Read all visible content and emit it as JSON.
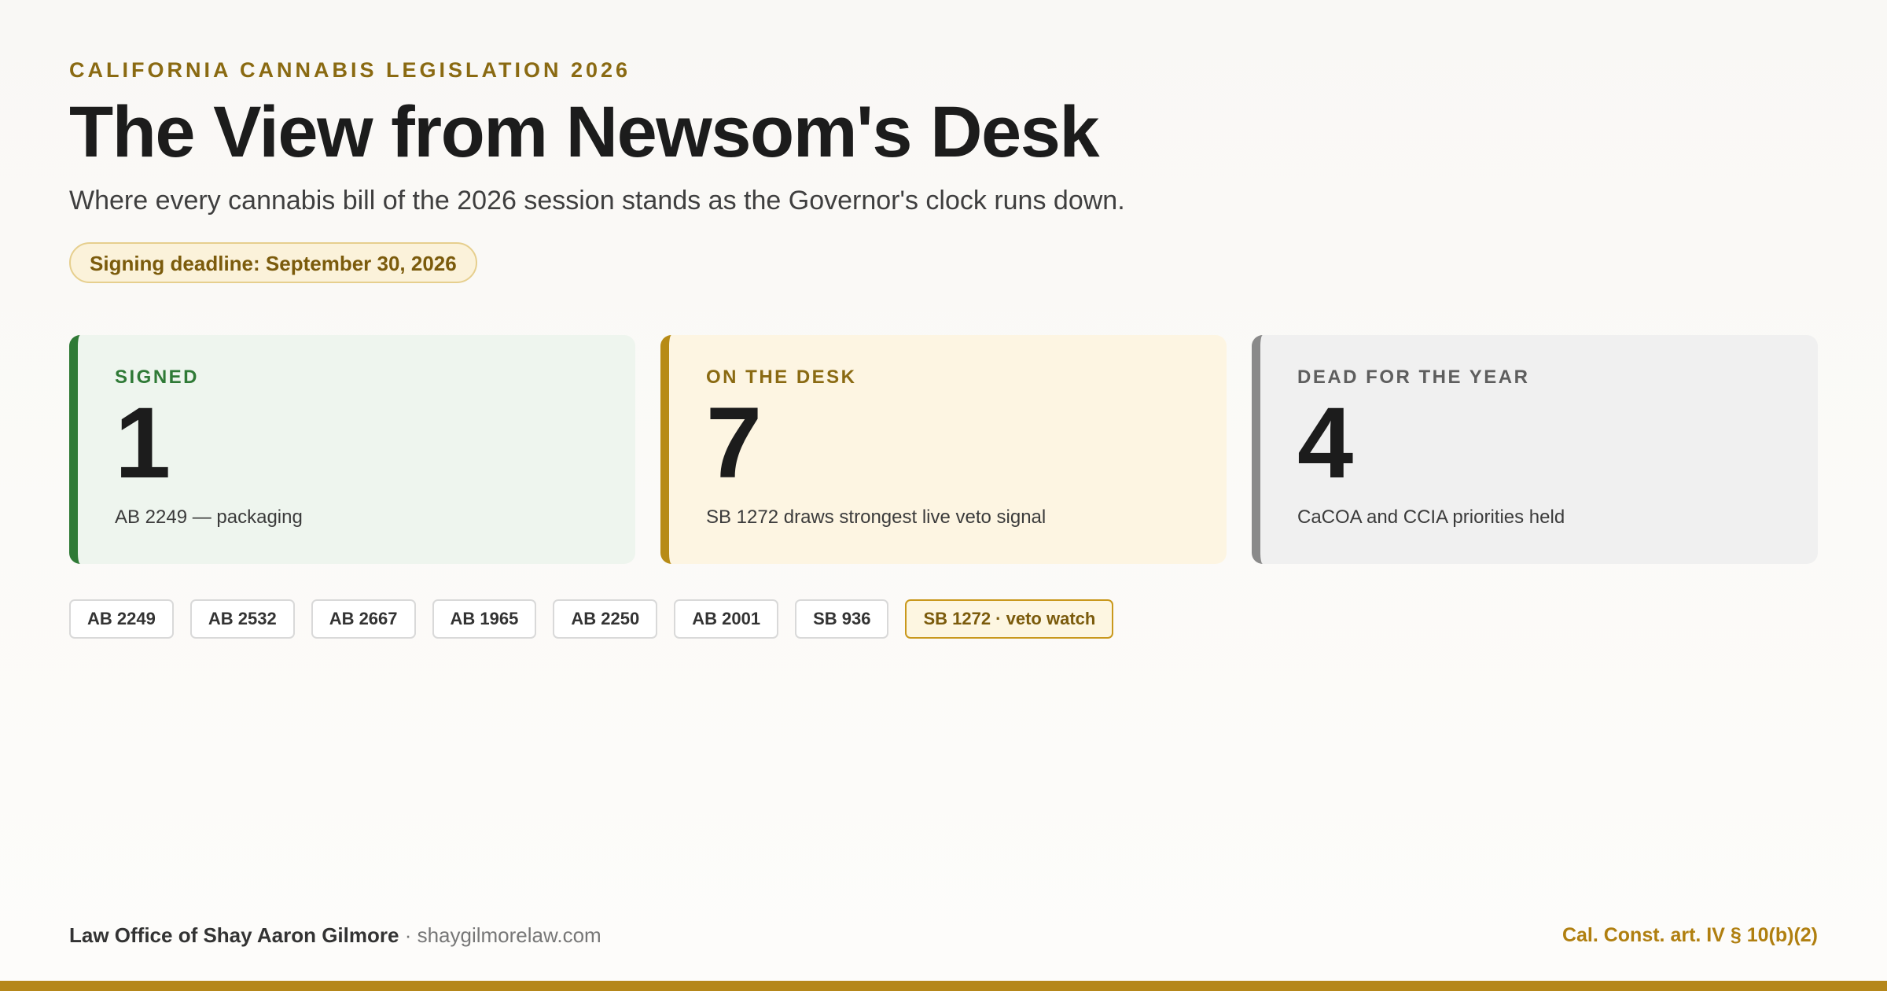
{
  "header": {
    "eyebrow": "CALIFORNIA CANNABIS LEGISLATION 2026",
    "title": "The View from Newsom's Desk",
    "subtitle": "Where every cannabis bill of the 2026 session stands as the Governor's clock runs down.",
    "deadline": "Signing deadline: September 30, 2026"
  },
  "cards": [
    {
      "label": "SIGNED",
      "count": "1",
      "note": "AB 2249 — packaging"
    },
    {
      "label": "ON THE DESK",
      "count": "7",
      "note": "SB 1272 draws strongest live veto signal"
    },
    {
      "label": "DEAD FOR THE YEAR",
      "count": "4",
      "note": "CaCOA and CCIA priorities held"
    }
  ],
  "bills": [
    "AB 2249",
    "AB 2532",
    "AB 2667",
    "AB 1965",
    "AB 2250",
    "AB 2001",
    "SB 936",
    "SB 1272 · veto watch"
  ],
  "footer": {
    "firm": "Law Office of Shay Aaron Gilmore",
    "separator": "·",
    "site": "shaygilmorelaw.com",
    "citation": "Cal. Const. art. IV § 10(b)(2)"
  },
  "colors": {
    "accent_gold": "#b5871a",
    "signed_green": "#2f7a36",
    "dead_gray": "#8a8a8a"
  }
}
